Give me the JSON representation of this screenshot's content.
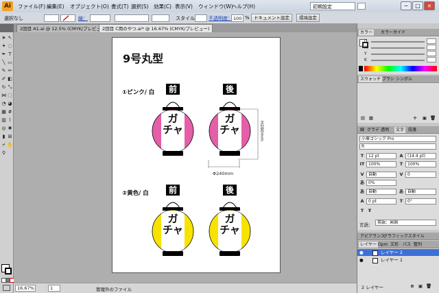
{
  "menu": {
    "logo": "Ai",
    "items": [
      "ファイル(F)",
      "編集(E)",
      "オブジェクト(O)",
      "書式(T)",
      "選択(S)",
      "効果(C)",
      "表示(V)",
      "ウィンドウ(W)",
      "ヘルプ(H)"
    ],
    "workspace": "初期設定",
    "window_buttons": [
      "−",
      "□",
      "×"
    ]
  },
  "control": {
    "selection": "選択なし",
    "stroke_label": "線：",
    "style_label": "スタイル：",
    "opacity_label": "不透明度：",
    "opacity_value": "100",
    "percent": "%",
    "document_setup": "ドキュメント設定",
    "preferences": "環境設定"
  },
  "tabs": [
    {
      "label": "2回目 A1.ai @ 12.5% (CMYK/プレビュー)",
      "active": false
    },
    {
      "label": "2回目 C用のやつ.ai* @ 16.67% (CMYK/プレビュー)",
      "active": true
    }
  ],
  "artboard": {
    "title": "9号丸型",
    "section1_label": "①ピンク/ 白",
    "section2_label": "②黄色/ 白",
    "front": "前",
    "back": "後",
    "lantern_text": "ガチャ",
    "height_label": "H280mm",
    "width_label": "Φ240mm"
  },
  "colors": {
    "pink": "#e45ea8",
    "yellow": "#f7e200"
  },
  "status": {
    "zoom": "16.67%",
    "page": "1",
    "info": "管理外のファイル"
  },
  "panels": {
    "color_tabs": [
      "カラー",
      "カラーガイド"
    ],
    "color_channels": [
      "C",
      "M",
      "Y",
      "K"
    ],
    "swatch_tabs": [
      "スウォッチ",
      "ブラシ",
      "シンボル"
    ],
    "char_tabs": [
      "線",
      "グラデ",
      "透明",
      "文字",
      "段落"
    ],
    "font_name": "小塚ゴシック Pro",
    "font_style": "R",
    "font_size": "12 pt",
    "leading": "(14.4 pt)",
    "scale_h": "100%",
    "scale_v": "100%",
    "kerning": "自動",
    "tracking": "0",
    "tsume": "0%",
    "aki_left": "自動",
    "aki_right": "自動",
    "baseline": "0 pt",
    "rotation": "0°",
    "language_label": "言語：",
    "language": "英語：米国",
    "appearance_tabs": [
      "アピアランス",
      "グラフィックスタイル"
    ],
    "layer_tabs": [
      "レイヤー",
      "Opm",
      "文形",
      "パス",
      "整列"
    ],
    "layers": [
      "レイヤー 2",
      "レイヤー 1"
    ],
    "layer_count": "2 レイヤー"
  }
}
